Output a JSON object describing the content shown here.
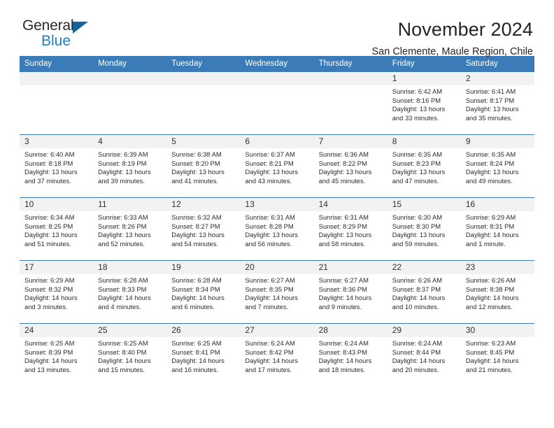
{
  "brand": {
    "name_top": "General",
    "name_bottom": "Blue",
    "triangle_icon": "blue-triangle-logo-mark"
  },
  "header": {
    "month_title": "November 2024",
    "location": "San Clemente, Maule Region, Chile"
  },
  "colors": {
    "header_blue": "#3b7cb8",
    "brand_blue": "#1f7fc4",
    "daynum_gray": "#f2f2f2",
    "text": "#2b2b2b"
  },
  "calendar": {
    "weekday_headers": [
      "Sunday",
      "Monday",
      "Tuesday",
      "Wednesday",
      "Thursday",
      "Friday",
      "Saturday"
    ],
    "weeks": [
      [
        {
          "day": "",
          "empty": true
        },
        {
          "day": "",
          "empty": true
        },
        {
          "day": "",
          "empty": true
        },
        {
          "day": "",
          "empty": true
        },
        {
          "day": "",
          "empty": true
        },
        {
          "day": "1",
          "sunrise": "Sunrise: 6:42 AM",
          "sunset": "Sunset: 8:16 PM",
          "daylight": "Daylight: 13 hours and 33 minutes."
        },
        {
          "day": "2",
          "sunrise": "Sunrise: 6:41 AM",
          "sunset": "Sunset: 8:17 PM",
          "daylight": "Daylight: 13 hours and 35 minutes."
        }
      ],
      [
        {
          "day": "3",
          "sunrise": "Sunrise: 6:40 AM",
          "sunset": "Sunset: 8:18 PM",
          "daylight": "Daylight: 13 hours and 37 minutes."
        },
        {
          "day": "4",
          "sunrise": "Sunrise: 6:39 AM",
          "sunset": "Sunset: 8:19 PM",
          "daylight": "Daylight: 13 hours and 39 minutes."
        },
        {
          "day": "5",
          "sunrise": "Sunrise: 6:38 AM",
          "sunset": "Sunset: 8:20 PM",
          "daylight": "Daylight: 13 hours and 41 minutes."
        },
        {
          "day": "6",
          "sunrise": "Sunrise: 6:37 AM",
          "sunset": "Sunset: 8:21 PM",
          "daylight": "Daylight: 13 hours and 43 minutes."
        },
        {
          "day": "7",
          "sunrise": "Sunrise: 6:36 AM",
          "sunset": "Sunset: 8:22 PM",
          "daylight": "Daylight: 13 hours and 45 minutes."
        },
        {
          "day": "8",
          "sunrise": "Sunrise: 6:35 AM",
          "sunset": "Sunset: 8:23 PM",
          "daylight": "Daylight: 13 hours and 47 minutes."
        },
        {
          "day": "9",
          "sunrise": "Sunrise: 6:35 AM",
          "sunset": "Sunset: 8:24 PM",
          "daylight": "Daylight: 13 hours and 49 minutes."
        }
      ],
      [
        {
          "day": "10",
          "sunrise": "Sunrise: 6:34 AM",
          "sunset": "Sunset: 8:25 PM",
          "daylight": "Daylight: 13 hours and 51 minutes."
        },
        {
          "day": "11",
          "sunrise": "Sunrise: 6:33 AM",
          "sunset": "Sunset: 8:26 PM",
          "daylight": "Daylight: 13 hours and 52 minutes."
        },
        {
          "day": "12",
          "sunrise": "Sunrise: 6:32 AM",
          "sunset": "Sunset: 8:27 PM",
          "daylight": "Daylight: 13 hours and 54 minutes."
        },
        {
          "day": "13",
          "sunrise": "Sunrise: 6:31 AM",
          "sunset": "Sunset: 8:28 PM",
          "daylight": "Daylight: 13 hours and 56 minutes."
        },
        {
          "day": "14",
          "sunrise": "Sunrise: 6:31 AM",
          "sunset": "Sunset: 8:29 PM",
          "daylight": "Daylight: 13 hours and 58 minutes."
        },
        {
          "day": "15",
          "sunrise": "Sunrise: 6:30 AM",
          "sunset": "Sunset: 8:30 PM",
          "daylight": "Daylight: 13 hours and 59 minutes."
        },
        {
          "day": "16",
          "sunrise": "Sunrise: 6:29 AM",
          "sunset": "Sunset: 8:31 PM",
          "daylight": "Daylight: 14 hours and 1 minute."
        }
      ],
      [
        {
          "day": "17",
          "sunrise": "Sunrise: 6:29 AM",
          "sunset": "Sunset: 8:32 PM",
          "daylight": "Daylight: 14 hours and 3 minutes."
        },
        {
          "day": "18",
          "sunrise": "Sunrise: 6:28 AM",
          "sunset": "Sunset: 8:33 PM",
          "daylight": "Daylight: 14 hours and 4 minutes."
        },
        {
          "day": "19",
          "sunrise": "Sunrise: 6:28 AM",
          "sunset": "Sunset: 8:34 PM",
          "daylight": "Daylight: 14 hours and 6 minutes."
        },
        {
          "day": "20",
          "sunrise": "Sunrise: 6:27 AM",
          "sunset": "Sunset: 8:35 PM",
          "daylight": "Daylight: 14 hours and 7 minutes."
        },
        {
          "day": "21",
          "sunrise": "Sunrise: 6:27 AM",
          "sunset": "Sunset: 8:36 PM",
          "daylight": "Daylight: 14 hours and 9 minutes."
        },
        {
          "day": "22",
          "sunrise": "Sunrise: 6:26 AM",
          "sunset": "Sunset: 8:37 PM",
          "daylight": "Daylight: 14 hours and 10 minutes."
        },
        {
          "day": "23",
          "sunrise": "Sunrise: 6:26 AM",
          "sunset": "Sunset: 8:38 PM",
          "daylight": "Daylight: 14 hours and 12 minutes."
        }
      ],
      [
        {
          "day": "24",
          "sunrise": "Sunrise: 6:25 AM",
          "sunset": "Sunset: 8:39 PM",
          "daylight": "Daylight: 14 hours and 13 minutes."
        },
        {
          "day": "25",
          "sunrise": "Sunrise: 6:25 AM",
          "sunset": "Sunset: 8:40 PM",
          "daylight": "Daylight: 14 hours and 15 minutes."
        },
        {
          "day": "26",
          "sunrise": "Sunrise: 6:25 AM",
          "sunset": "Sunset: 8:41 PM",
          "daylight": "Daylight: 14 hours and 16 minutes."
        },
        {
          "day": "27",
          "sunrise": "Sunrise: 6:24 AM",
          "sunset": "Sunset: 8:42 PM",
          "daylight": "Daylight: 14 hours and 17 minutes."
        },
        {
          "day": "28",
          "sunrise": "Sunrise: 6:24 AM",
          "sunset": "Sunset: 8:43 PM",
          "daylight": "Daylight: 14 hours and 18 minutes."
        },
        {
          "day": "29",
          "sunrise": "Sunrise: 6:24 AM",
          "sunset": "Sunset: 8:44 PM",
          "daylight": "Daylight: 14 hours and 20 minutes."
        },
        {
          "day": "30",
          "sunrise": "Sunrise: 6:23 AM",
          "sunset": "Sunset: 8:45 PM",
          "daylight": "Daylight: 14 hours and 21 minutes."
        }
      ]
    ]
  }
}
